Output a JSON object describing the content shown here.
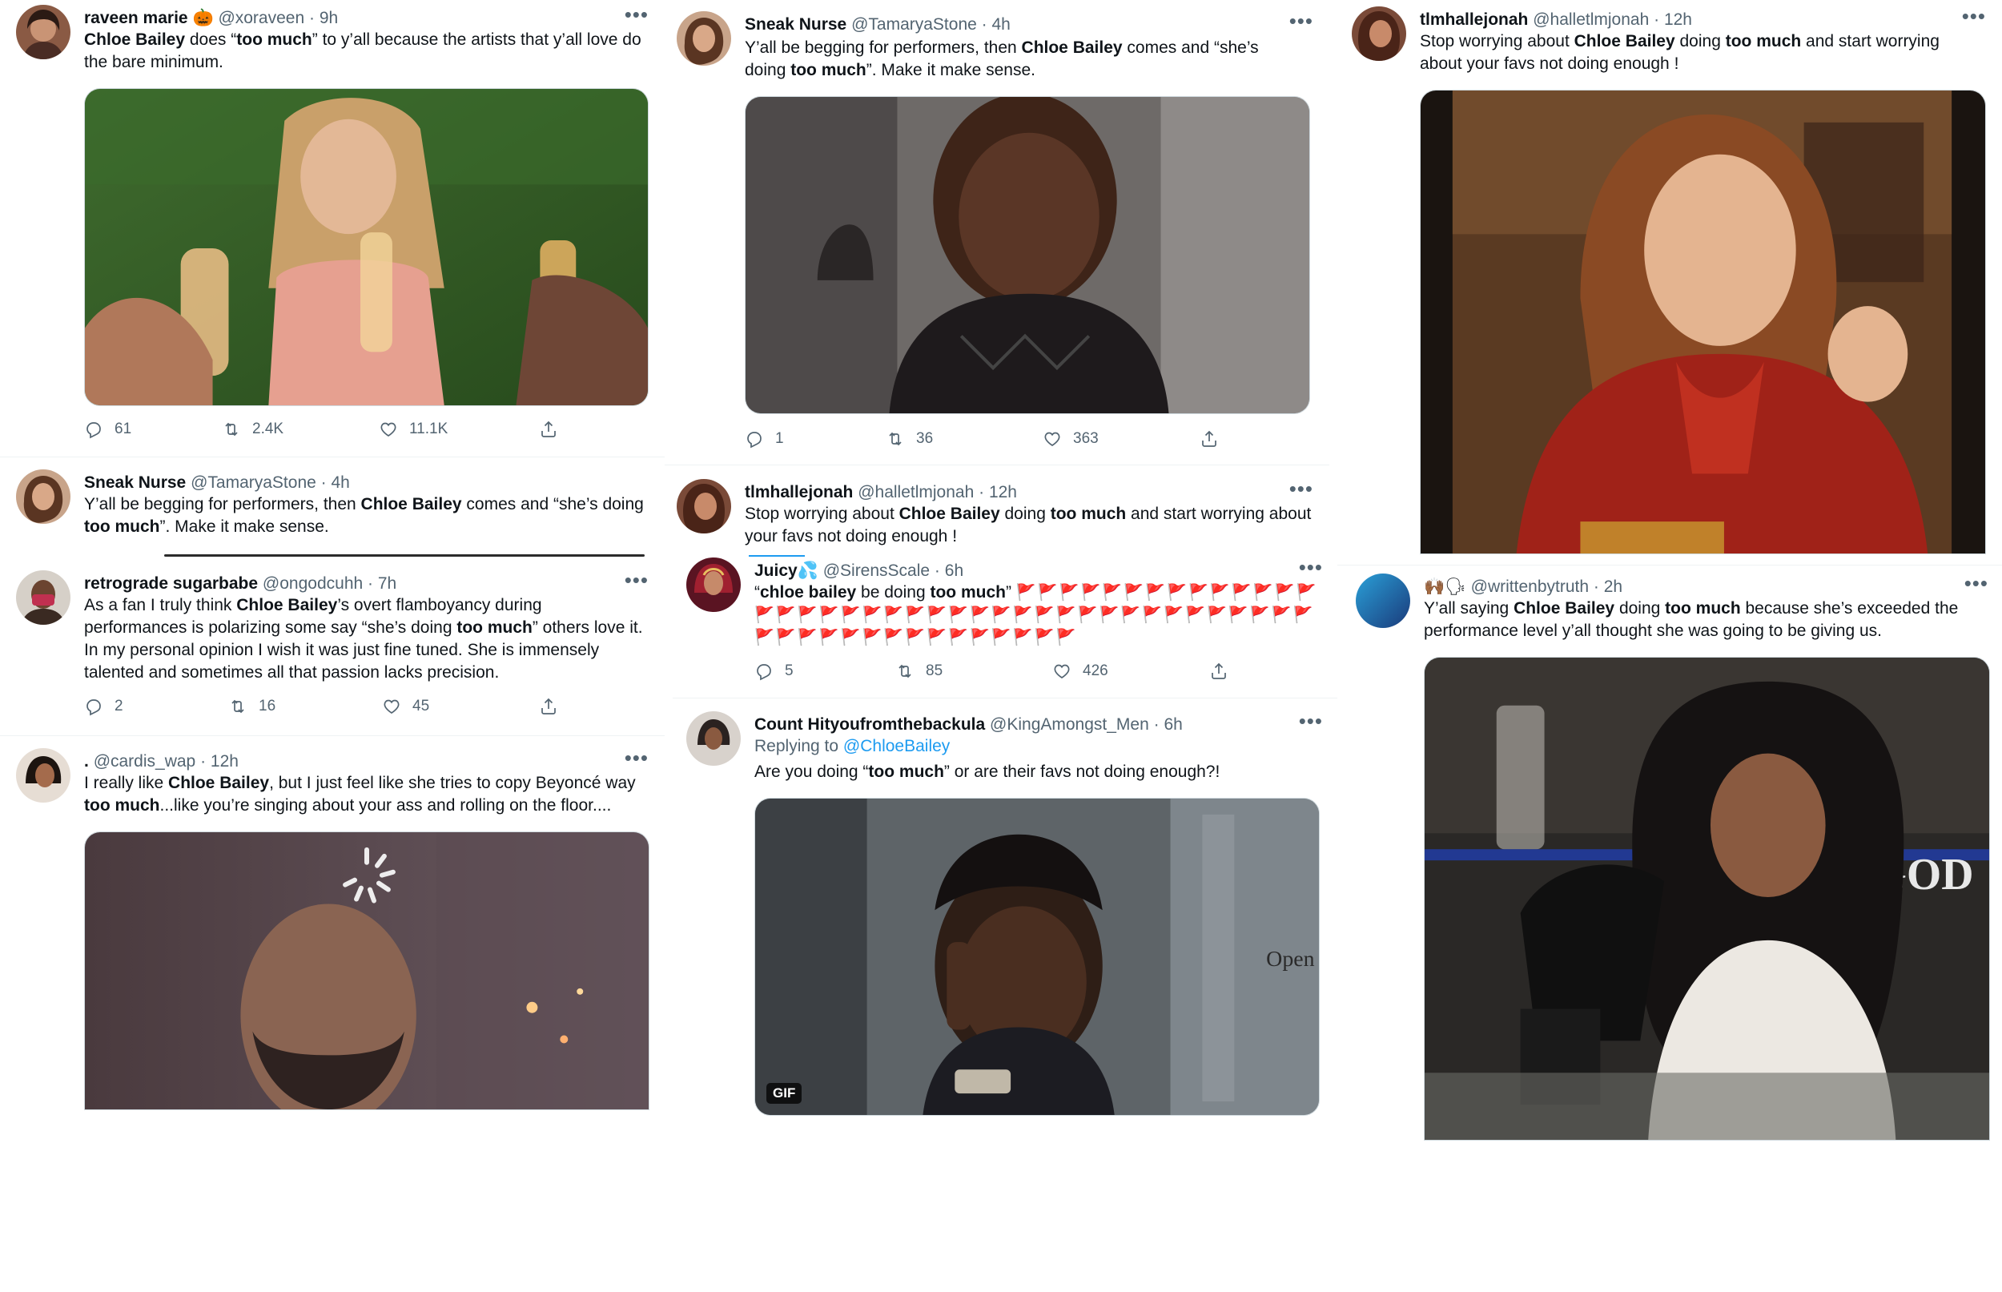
{
  "colors": {
    "accent": "#1d9bf0",
    "text": "#0f1419",
    "muted": "#536471",
    "flag": "#e0245e"
  },
  "icons": {
    "reply": "reply-icon",
    "retweet": "retweet-icon",
    "like": "heart-icon",
    "share": "share-icon",
    "more": "more-icon"
  },
  "tweets": {
    "t1": {
      "name": "raveen marie",
      "emoji": "🎃",
      "handle": "@xoraveen",
      "sep": "·",
      "time": "9h",
      "b1": "Chloe Bailey",
      "t1": " does “",
      "b2": "too much",
      "t2": "” to y’all because the artists that y’all love do the bare minimum.",
      "replies": "61",
      "retweets": "2.4K",
      "likes": "11.1K"
    },
    "t2": {
      "name": "Sneak Nurse",
      "handle": "@TamaryaStone",
      "sep": "·",
      "time": "4h",
      "t1": "Y’all be begging for performers, then ",
      "b1": "Chloe Bailey",
      "t2": " comes and “she’s doing ",
      "b2": "too much",
      "t3": "”. Make it make sense."
    },
    "t3": {
      "name": "retrograde sugarbabe",
      "handle": "@ongodcuhh",
      "sep": "·",
      "time": "7h",
      "t1": "As a fan I truly think ",
      "b1": "Chloe Bailey",
      "t2": "’s overt flamboyancy during performances is polarizing some say “she’s doing ",
      "b2": "too much",
      "t3": "” others love it. In my personal opinion I wish it was just fine tuned. She is immensely talented and sometimes all that passion lacks precision.",
      "replies": "2",
      "retweets": "16",
      "likes": "45"
    },
    "t4": {
      "name": ".",
      "handle": "@cardis_wap",
      "sep": "·",
      "time": "12h",
      "t1": "I really like ",
      "b1": "Chloe Bailey",
      "t2": ", but I just feel like she tries to copy Beyoncé way ",
      "b2": "too much",
      "t3": "...like you’re singing about your ass and rolling on the floor...."
    },
    "t5": {
      "name": "Sneak Nurse",
      "handle": "@TamaryaStone",
      "sep": "·",
      "time": "4h",
      "t1": "Y’all be begging for performers, then ",
      "b1": "Chloe Bailey",
      "t2": " comes and “she’s doing ",
      "b2": "too much",
      "t3": "”. Make it make sense.",
      "replies": "1",
      "retweets": "36",
      "likes": "363"
    },
    "t6": {
      "name": "tlmhallejonah",
      "handle": "@halletlmjonah",
      "sep": "·",
      "time": "12h",
      "t1": "Stop worrying about ",
      "b1": "Chloe Bailey",
      "t2": " doing ",
      "b2": "too much",
      "t3": " and start worrying about your favs not doing enough !"
    },
    "t7": {
      "name": "Juicy",
      "emoji": "💦",
      "handle": "@SirensScale",
      "sep": "·",
      "time": "6h",
      "t1": "“",
      "b1": "chloe bailey",
      "t2": " be doing ",
      "b2": "too much",
      "t3": "”",
      "flags": "🚩🚩🚩🚩🚩🚩🚩🚩🚩🚩🚩🚩🚩🚩🚩🚩🚩🚩🚩🚩🚩🚩🚩🚩🚩🚩🚩🚩🚩🚩🚩🚩🚩🚩🚩🚩🚩🚩🚩🚩🚩🚩🚩🚩🚩🚩🚩🚩🚩🚩🚩🚩🚩🚩🚩",
      "replies": "5",
      "retweets": "85",
      "likes": "426"
    },
    "t8": {
      "name": "Count Hityoufromthebackula",
      "handle": "@KingAmongst_Men",
      "sep": "·",
      "time": "6h",
      "reply_prefix": "Replying to ",
      "reply_to": "@ChloeBailey",
      "t1": "Are you doing “",
      "b1": "too much",
      "t2": "” or are their favs not doing enough?!",
      "gif": "GIF"
    },
    "t9": {
      "name": "tlmhallejonah",
      "handle": "@halletlmjonah",
      "sep": "·",
      "time": "12h",
      "t1": "Stop worrying about ",
      "b1": "Chloe Bailey",
      "t2": " doing ",
      "b2": "too much",
      "t3": " and start worrying about your favs not doing enough !"
    },
    "t10": {
      "emoji": "🙌🏾🗣",
      "handle": "@writtenbytruth",
      "sep": "·",
      "time": "2h",
      "t1": "Y’all saying ",
      "b1": "Chloe Bailey",
      "t2": " doing ",
      "b2": "too much",
      "t3": " because she’s exceeded the performance level y’all thought she was going to be giving us."
    }
  }
}
